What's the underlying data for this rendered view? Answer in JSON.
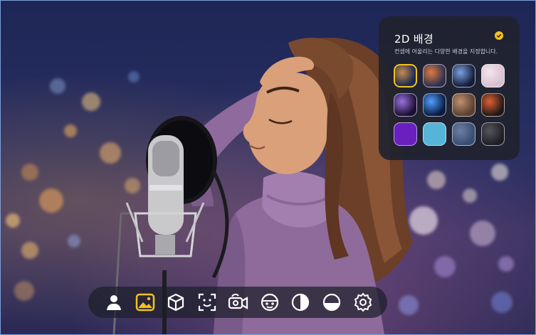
{
  "panel": {
    "title": "2D 배경",
    "description": "컨셉에 어울리는 다양한 배경을 지정합니다.",
    "selected_index": 0,
    "thumbnails": [
      {
        "name": "city-night-bokeh",
        "colors": [
          "#1a2a55",
          "#c88a4a"
        ]
      },
      {
        "name": "city-dusk",
        "colors": [
          "#2a3050",
          "#e07a40"
        ]
      },
      {
        "name": "city-lights",
        "colors": [
          "#141c3a",
          "#7aa0e0"
        ]
      },
      {
        "name": "pink-bokeh",
        "colors": [
          "#d8c0d0",
          "#f4e4ee"
        ]
      },
      {
        "name": "purple-lines",
        "colors": [
          "#1a1030",
          "#9a70e0"
        ]
      },
      {
        "name": "blue-network",
        "colors": [
          "#0a1a40",
          "#50a0ff"
        ]
      },
      {
        "name": "brown-geometric",
        "colors": [
          "#5a4030",
          "#c09070"
        ]
      },
      {
        "name": "dark-orange-bokeh",
        "colors": [
          "#201818",
          "#e06030"
        ]
      },
      {
        "name": "solid-purple",
        "colors": [
          "#6a1fbf",
          "#6a1fbf"
        ]
      },
      {
        "name": "solid-sky-blue",
        "colors": [
          "#56b4d8",
          "#56b4d8"
        ]
      },
      {
        "name": "slate-gradient",
        "colors": [
          "#3a4c70",
          "#6c80a8"
        ]
      },
      {
        "name": "dark-stripes",
        "colors": [
          "#1e1e24",
          "#55555e"
        ]
      }
    ]
  },
  "toolbar": {
    "active": "background-tool",
    "tools": [
      {
        "name": "avatar-tool",
        "icon": "person-icon"
      },
      {
        "name": "background-tool",
        "icon": "image-icon"
      },
      {
        "name": "3d-object-tool",
        "icon": "cube-icon"
      },
      {
        "name": "face-tracking-tool",
        "icon": "face-scan-icon"
      },
      {
        "name": "camera-tool",
        "icon": "camera-rotate-icon"
      },
      {
        "name": "sticker-tool",
        "icon": "face-sticker-icon"
      },
      {
        "name": "contrast-tool",
        "icon": "half-circle-icon"
      },
      {
        "name": "filter-tool",
        "icon": "filter-circle-icon"
      },
      {
        "name": "settings-tool",
        "icon": "gear-icon"
      }
    ]
  },
  "colors": {
    "accent": "#f3c21b",
    "panel_bg": "#20222e",
    "toolbar_bg": "#1c1e2a"
  }
}
